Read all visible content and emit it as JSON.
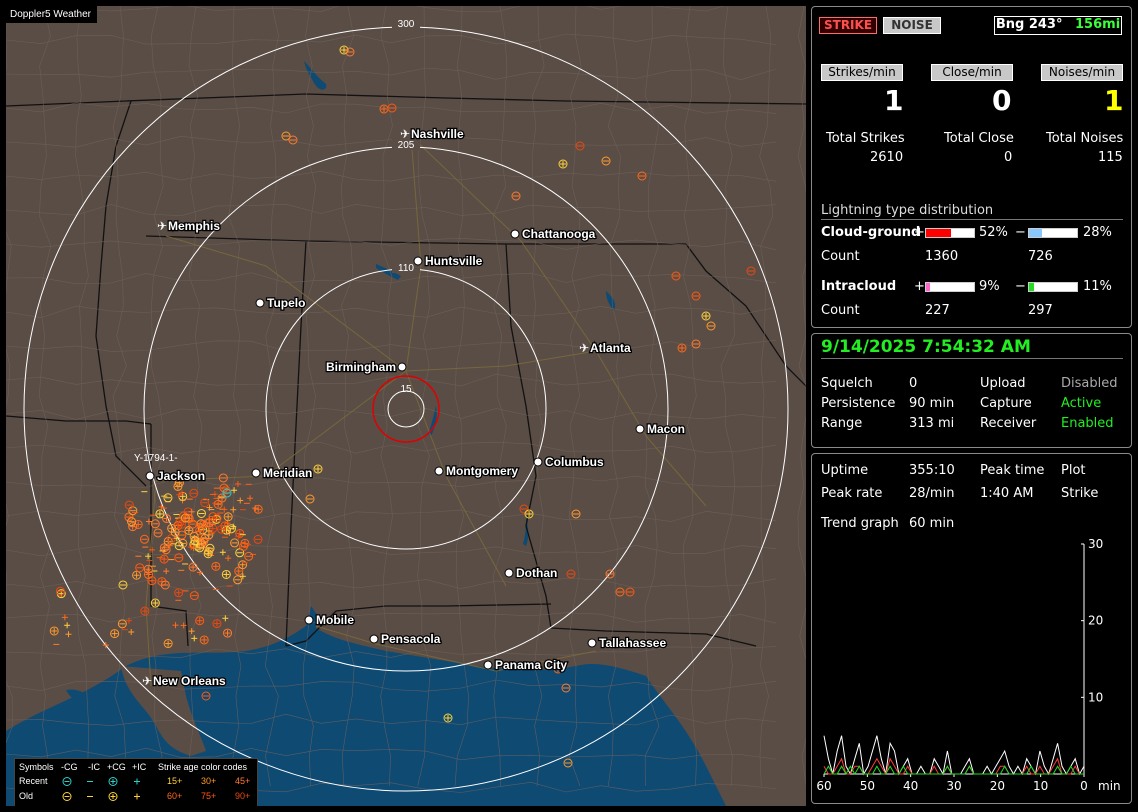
{
  "app_title": "Doppler5 Weather",
  "map": {
    "cities": [
      {
        "name": "Nashville",
        "airport": true
      },
      {
        "name": "Memphis",
        "airport": true
      },
      {
        "name": "Chattanooga",
        "airport": false
      },
      {
        "name": "Huntsville",
        "airport": false
      },
      {
        "name": "Tupelo",
        "airport": false
      },
      {
        "name": "Atlanta",
        "airport": true
      },
      {
        "name": "Birmingham",
        "airport": false
      },
      {
        "name": "Macon",
        "airport": false
      },
      {
        "name": "Jackson",
        "airport": false
      },
      {
        "name": "Meridian",
        "airport": false
      },
      {
        "name": "Montgomery",
        "airport": false
      },
      {
        "name": "Columbus",
        "airport": false
      },
      {
        "name": "Dothan",
        "airport": false
      },
      {
        "name": "Mobile",
        "airport": false
      },
      {
        "name": "Pensacola",
        "airport": false
      },
      {
        "name": "Tallahassee",
        "airport": false
      },
      {
        "name": "Panama City",
        "airport": false
      },
      {
        "name": "New Orleans",
        "airport": true
      }
    ],
    "range_rings": [
      "300",
      "205",
      "110",
      "15"
    ],
    "marker_label": "Y-1794-1-"
  },
  "legend": {
    "header": [
      "Symbols",
      "-CG",
      "-IC",
      "+CG",
      "+IC",
      "Strike age color codes"
    ],
    "recent_label": "Recent",
    "old_label": "Old",
    "recent_ages": [
      "15+",
      "30+",
      "45+"
    ],
    "old_ages": [
      "60+",
      "75+",
      "90+"
    ],
    "age_colors": [
      "#ffd23c",
      "#ff9a2e",
      "#ff7a2e",
      "#ff6a1a",
      "#ff5a10",
      "#e84a10"
    ]
  },
  "status": {
    "strike_label": "STRIKE",
    "noise_label": "NOISE",
    "bearing": "Bng 243°",
    "distance": "156mi"
  },
  "rates": {
    "strikes_label": "Strikes/min",
    "close_label": "Close/min",
    "noises_label": "Noises/min",
    "strikes_value": "1",
    "close_value": "0",
    "noises_value": "1"
  },
  "totals": {
    "strikes_label": "Total Strikes",
    "close_label": "Total Close",
    "noises_label": "Total Noises",
    "strikes_value": "2610",
    "close_value": "0",
    "noises_value": "115"
  },
  "distribution": {
    "title": "Lightning type distribution",
    "cg_label": "Cloud-ground",
    "ic_label": "Intracloud",
    "count_label": "Count",
    "plus": "+",
    "minus": "−",
    "cg_pos_pct": "52%",
    "cg_neg_pct": "28%",
    "ic_pos_pct": "9%",
    "ic_neg_pct": "11%",
    "cg_pos_fill": 0.52,
    "cg_neg_fill": 0.28,
    "ic_pos_fill": 0.09,
    "ic_neg_fill": 0.11,
    "cg_pos_count": "1360",
    "cg_neg_count": "726",
    "ic_pos_count": "227",
    "ic_neg_count": "297",
    "colors": {
      "cg_pos": "#ff0000",
      "cg_neg": "#88c8ff",
      "ic_pos": "#ff66cc",
      "ic_neg": "#22dd22"
    }
  },
  "settings": {
    "datetime": "9/14/2025 7:54:32 AM",
    "squelch_label": "Squelch",
    "squelch_value": "0",
    "persistence_label": "Persistence",
    "persistence_value": "90 min",
    "range_label": "Range",
    "range_value": "313 mi",
    "upload_label": "Upload",
    "upload_value": "Disabled",
    "capture_label": "Capture",
    "capture_value": "Active",
    "receiver_label": "Receiver",
    "receiver_value": "Enabled"
  },
  "stats": {
    "uptime_label": "Uptime",
    "uptime_value": "355:10",
    "peak_time_label": "Peak time",
    "peak_time_value": "1:40 AM",
    "plot_label": "Plot",
    "plot_value": "Strike",
    "peak_rate_label": "Peak rate",
    "peak_rate_value": "28/min",
    "trend_label": "Trend graph",
    "trend_value": "60 min"
  },
  "chart_data": {
    "type": "line",
    "xlabel": "min",
    "x_ticks": [
      "60",
      "50",
      "40",
      "30",
      "20",
      "10",
      "0"
    ],
    "y_ticks": [
      "30",
      "20",
      "10"
    ],
    "xlim": [
      60,
      0
    ],
    "ylim": [
      0,
      30
    ],
    "series": [
      {
        "values": [
          5,
          2,
          0,
          3,
          5,
          1,
          0,
          2,
          4,
          0,
          1,
          3,
          5,
          2,
          0,
          4,
          3,
          0,
          1,
          2,
          0,
          0,
          1,
          0,
          0,
          2,
          1,
          0,
          3,
          0,
          0,
          0,
          1,
          2,
          0,
          0,
          0,
          1,
          0,
          1,
          2,
          3,
          1,
          0,
          1,
          0,
          2,
          1,
          0,
          3,
          1,
          0,
          2,
          4,
          1,
          0,
          1,
          2,
          0,
          1
        ]
      },
      {
        "values": [
          1,
          0,
          0,
          1,
          2,
          0,
          0,
          1,
          1,
          0,
          0,
          1,
          2,
          1,
          0,
          2,
          1,
          0,
          0,
          1,
          0,
          0,
          0,
          0,
          0,
          1,
          0,
          0,
          1,
          0,
          0,
          0,
          0,
          1,
          0,
          0,
          0,
          0,
          0,
          0,
          1,
          1,
          0,
          0,
          0,
          0,
          1,
          0,
          0,
          1,
          0,
          0,
          1,
          2,
          0,
          0,
          0,
          1,
          0,
          0
        ]
      },
      {
        "values": [
          0,
          1,
          0,
          0,
          1,
          0,
          1,
          0,
          1,
          0,
          0,
          0,
          1,
          0,
          0,
          1,
          0,
          0,
          1,
          0,
          0,
          0,
          0,
          0,
          0,
          0,
          0,
          0,
          1,
          0,
          0,
          0,
          0,
          1,
          0,
          0,
          0,
          0,
          0,
          0,
          0,
          1,
          0,
          0,
          0,
          0,
          0,
          1,
          0,
          0,
          0,
          0,
          0,
          1,
          0,
          0,
          1,
          0,
          0,
          0
        ]
      }
    ]
  }
}
